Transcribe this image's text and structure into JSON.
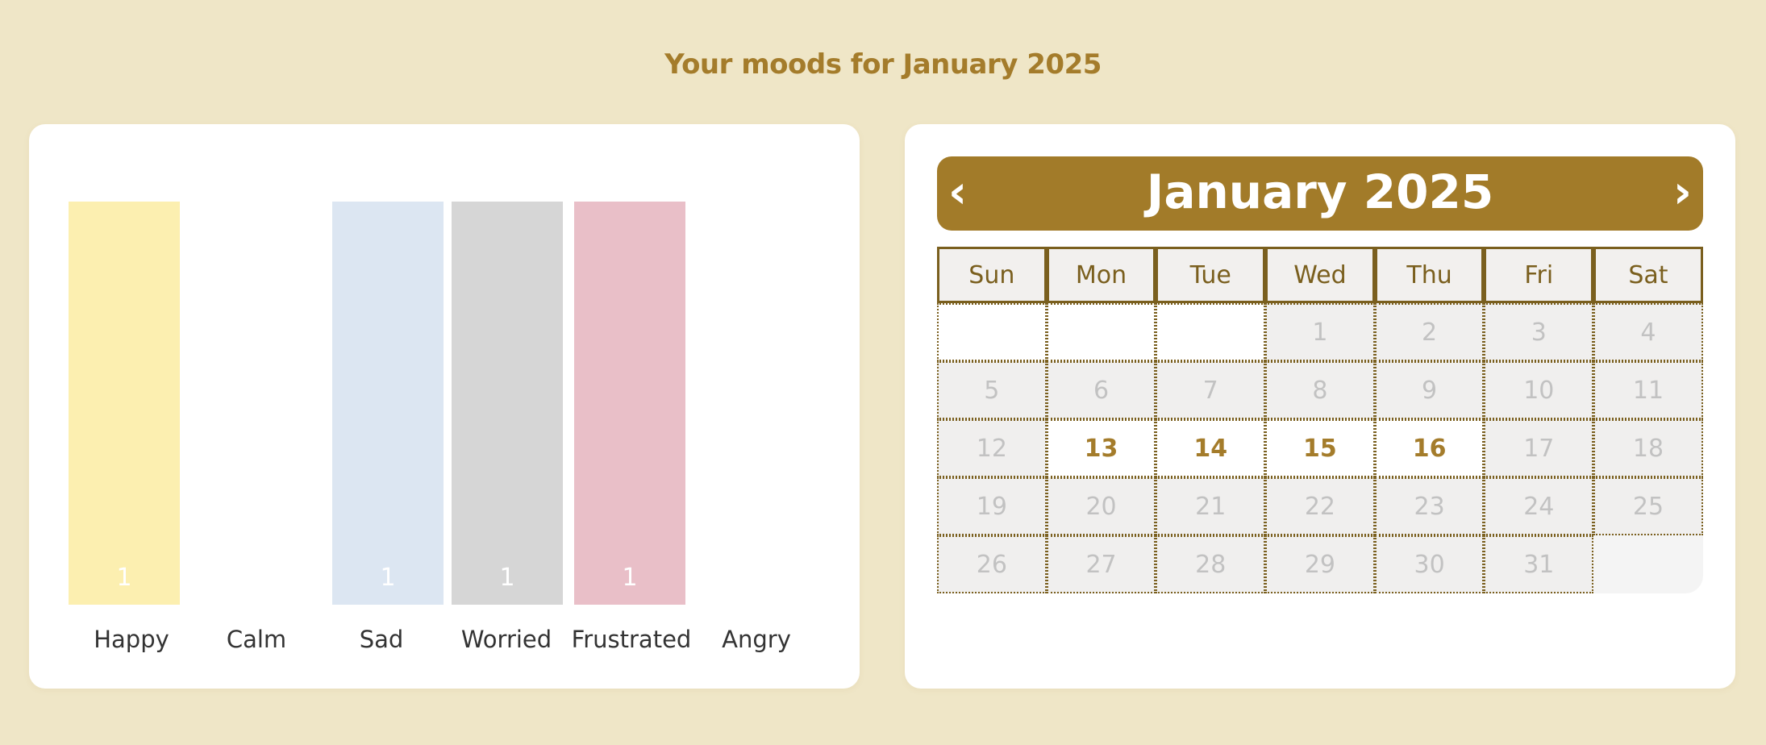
{
  "page": {
    "title": "Your moods for January 2025"
  },
  "chart_data": {
    "type": "bar",
    "categories": [
      "Happy",
      "Calm",
      "Sad",
      "Worried",
      "Frustrated",
      "Angry"
    ],
    "values": [
      1,
      0,
      1,
      1,
      1,
      0
    ],
    "value_labels": [
      "1",
      "",
      "1",
      "1",
      "1",
      ""
    ],
    "colors": [
      "#fcefb0",
      "#ffffff",
      "#dce6f2",
      "#d6d6d6",
      "#e9bfc8",
      "#ffffff"
    ],
    "ylim": [
      0,
      1
    ],
    "title": "",
    "xlabel": "",
    "ylabel": "",
    "grid": false,
    "legend": "none"
  },
  "calendar": {
    "title": "January 2025",
    "prev_label": "‹",
    "next_label": "›",
    "weekdays": [
      "Sun",
      "Mon",
      "Tue",
      "Wed",
      "Thu",
      "Fri",
      "Sat"
    ],
    "weeks": [
      [
        "",
        "",
        "",
        "1",
        "2",
        "3",
        "4"
      ],
      [
        "5",
        "6",
        "7",
        "8",
        "9",
        "10",
        "11"
      ],
      [
        "12",
        "13",
        "14",
        "15",
        "16",
        "17",
        "18"
      ],
      [
        "19",
        "20",
        "21",
        "22",
        "23",
        "24",
        "25"
      ],
      [
        "26",
        "27",
        "28",
        "29",
        "30",
        "31",
        ""
      ]
    ],
    "highlighted_days": [
      "13",
      "14",
      "15",
      "16"
    ],
    "accent_color": "#a27b29"
  }
}
